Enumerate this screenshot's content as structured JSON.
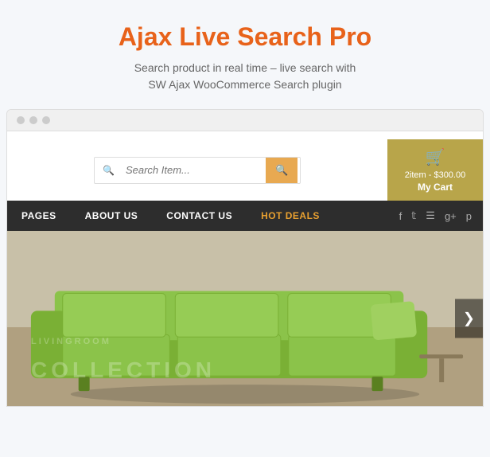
{
  "header": {
    "title": "Ajax Live Search Pro",
    "subtitle": "Search product in real time - live search with\nSW Ajax WooCommerce Search plugin"
  },
  "browser": {
    "dots": [
      "dot1",
      "dot2",
      "dot3"
    ]
  },
  "search": {
    "placeholder": "Search Item...",
    "button_icon": "🔍"
  },
  "cart": {
    "icon": "🛒",
    "info": "2item - $300.00",
    "label": "My Cart"
  },
  "nav": {
    "items": [
      {
        "label": "PAGES",
        "hot": false
      },
      {
        "label": "ABOUT US",
        "hot": false
      },
      {
        "label": "CONTACT US",
        "hot": false
      },
      {
        "label": "HOT DEALS",
        "hot": true
      }
    ],
    "social_icons": [
      "f",
      "t",
      "rss",
      "g+",
      "p"
    ]
  },
  "hero": {
    "overlay_line1": "LIVINGROOM",
    "overlay_line2": "COLLECTION",
    "next_btn": "❯"
  }
}
